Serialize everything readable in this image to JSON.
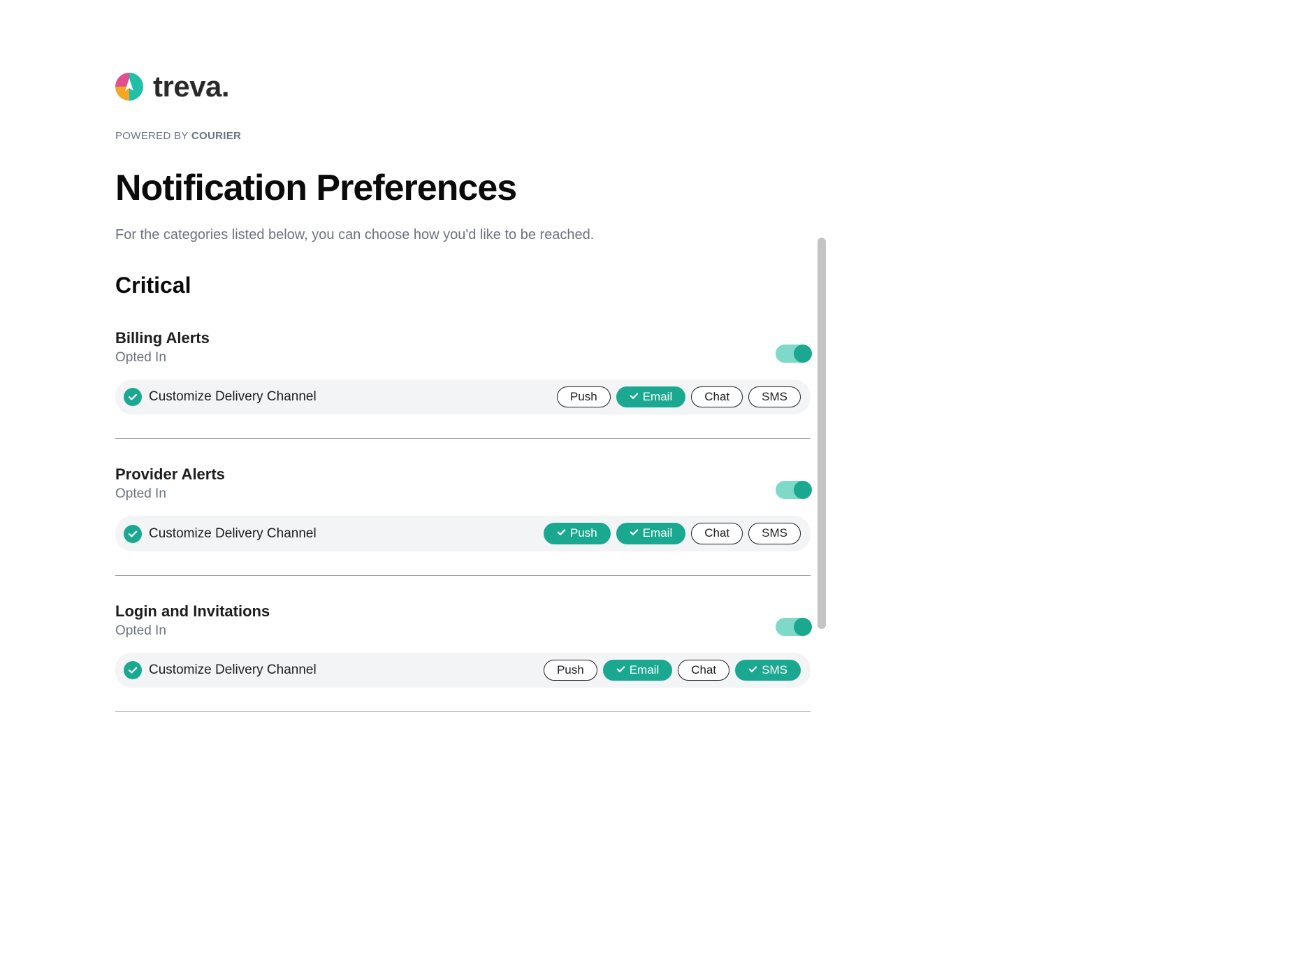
{
  "brand": {
    "name": "treva.",
    "powered_prefix": "POWERED BY ",
    "powered_name": "COURIER"
  },
  "page": {
    "title": "Notification Preferences",
    "subtitle": "For the categories listed below, you can choose how you'd like to be reached."
  },
  "section": {
    "title": "Critical"
  },
  "channels": {
    "push": "Push",
    "email": "Email",
    "chat": "Chat",
    "sms": "SMS"
  },
  "customize_label": "Customize Delivery Channel",
  "opted_in_label": "Opted In",
  "groups": [
    {
      "name": "Billing Alerts",
      "status": "Opted In",
      "toggle": true,
      "channels": {
        "push": false,
        "email": true,
        "chat": false,
        "sms": false
      }
    },
    {
      "name": "Provider Alerts",
      "status": "Opted In",
      "toggle": true,
      "channels": {
        "push": true,
        "email": true,
        "chat": false,
        "sms": false
      }
    },
    {
      "name": "Login and Invitations",
      "status": "Opted In",
      "toggle": true,
      "channels": {
        "push": false,
        "email": true,
        "chat": false,
        "sms": true
      }
    }
  ]
}
